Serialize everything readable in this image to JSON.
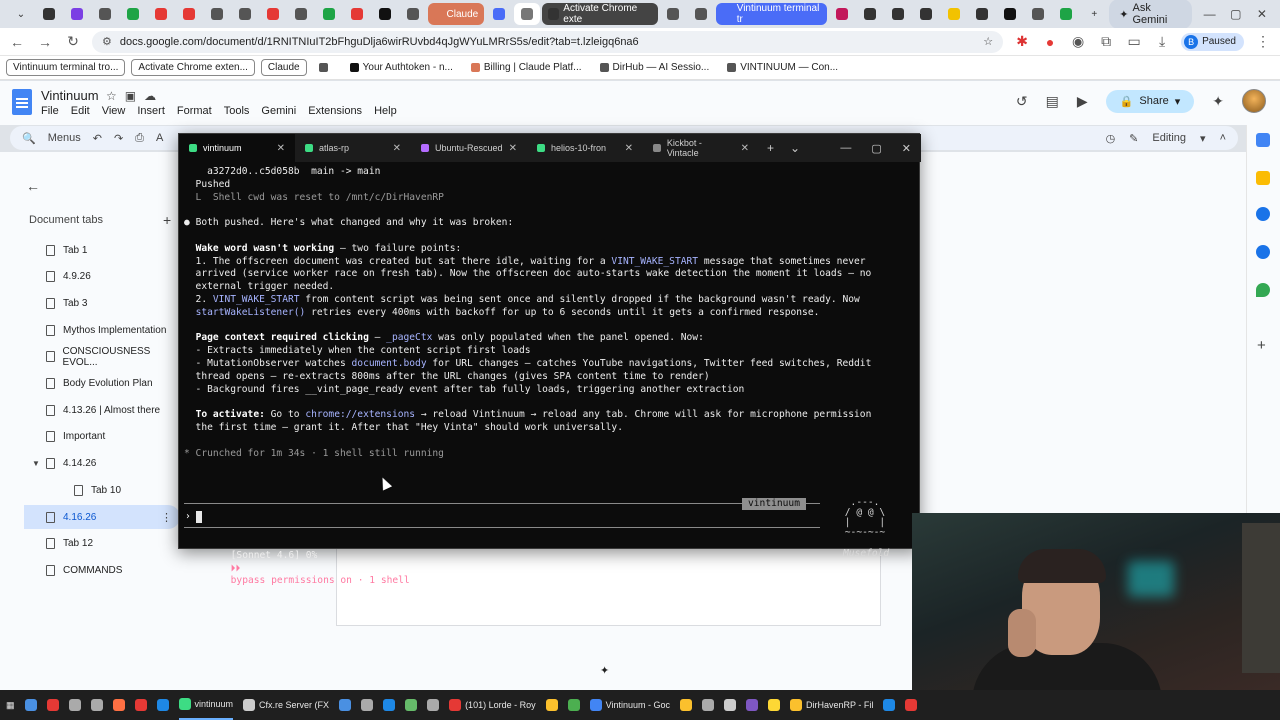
{
  "browser": {
    "tabs": [
      {
        "label": "",
        "color": "#333333"
      },
      {
        "label": "",
        "color": "#7b3fe4"
      },
      {
        "label": "",
        "color": "#555555"
      },
      {
        "label": "",
        "color": "#1ea446"
      },
      {
        "label": "",
        "color": "#e53935"
      },
      {
        "label": "",
        "color": "#e53935"
      },
      {
        "label": "",
        "color": "#555555"
      },
      {
        "label": "",
        "color": "#555555"
      },
      {
        "label": "",
        "color": "#e53935"
      },
      {
        "label": "",
        "color": "#555555"
      },
      {
        "label": "",
        "color": "#1ea446"
      },
      {
        "label": "",
        "color": "#e53935"
      },
      {
        "label": "",
        "color": "#111111"
      },
      {
        "label": "",
        "color": "#555555"
      },
      {
        "label": "Claude",
        "color": "#d97757"
      },
      {
        "label": "",
        "color": "#4a6cf7"
      },
      {
        "label": "",
        "color": "#777777"
      },
      {
        "label": "Activate Chrome exte",
        "color": "#333333"
      },
      {
        "label": "",
        "color": "#555555"
      },
      {
        "label": "",
        "color": "#555555"
      },
      {
        "label": "Vintinuum terminal tr",
        "color": "#4a6cf7"
      },
      {
        "label": "",
        "color": "#c2185b"
      },
      {
        "label": "",
        "color": "#333333"
      },
      {
        "label": "",
        "color": "#333333"
      },
      {
        "label": "",
        "color": "#333333"
      },
      {
        "label": "",
        "color": "#f2c200"
      },
      {
        "label": "",
        "color": "#333333"
      },
      {
        "label": "",
        "color": "#111111"
      },
      {
        "label": "",
        "color": "#555555"
      },
      {
        "label": "",
        "color": "#1ea446"
      }
    ],
    "new_tab": "+",
    "ask_gemini": "Ask Gemini",
    "window_controls": {
      "minimize": "—",
      "maximize": "▢",
      "close": "✕"
    },
    "url": "docs.google.com/document/d/1RNITNIuIT2bFhguDlja6wirRUvbd4qJgWYuLMRrS5s/edit?tab=t.lzleigq6na6",
    "profile_initial": "B",
    "profile_status": "Paused",
    "bookmarks": [
      {
        "label": "Vintinuum terminal tro...",
        "boxed": true,
        "color": ""
      },
      {
        "label": "Activate Chrome exten...",
        "boxed": true,
        "color": ""
      },
      {
        "label": "Claude",
        "boxed": true,
        "color": ""
      },
      {
        "label": "",
        "boxed": false,
        "color": "#555555"
      },
      {
        "label": "Your Authtoken - n...",
        "boxed": false,
        "color": "#111111"
      },
      {
        "label": "Billing | Claude Platf...",
        "boxed": false,
        "color": "#d97757"
      },
      {
        "label": "DirHub — AI Sessio...",
        "boxed": false,
        "color": "#555555"
      },
      {
        "label": "VINTINUUM — Con...",
        "boxed": false,
        "color": "#555555"
      }
    ]
  },
  "docs": {
    "title": "Vintinuum",
    "menu": [
      "File",
      "Edit",
      "View",
      "Insert",
      "Format",
      "Tools",
      "Gemini",
      "Extensions",
      "Help"
    ],
    "share_label": "Share",
    "toolbar_menus": "Menus",
    "editing_label": "Editing",
    "sidebar_heading": "Document tabs",
    "sidebar_add": "+",
    "tabs": [
      {
        "label": "Tab 1",
        "child": false,
        "selected": false,
        "expanded": false
      },
      {
        "label": "4.9.26",
        "child": false,
        "selected": false,
        "expanded": false
      },
      {
        "label": "Tab 3",
        "child": false,
        "selected": false,
        "expanded": false
      },
      {
        "label": "Mythos Implementation",
        "child": false,
        "selected": false,
        "expanded": false
      },
      {
        "label": "CONSCIOUSNESS EVOL...",
        "child": false,
        "selected": false,
        "expanded": false
      },
      {
        "label": "Body Evolution Plan",
        "child": false,
        "selected": false,
        "expanded": false
      },
      {
        "label": "4.13.26 | Almost there",
        "child": false,
        "selected": false,
        "expanded": false
      },
      {
        "label": "Important",
        "child": false,
        "selected": false,
        "expanded": false
      },
      {
        "label": "4.14.26",
        "child": false,
        "selected": false,
        "expanded": true
      },
      {
        "label": "Tab 10",
        "child": true,
        "selected": false,
        "expanded": false
      },
      {
        "label": "4.16.26",
        "child": false,
        "selected": true,
        "expanded": false
      },
      {
        "label": "Tab 12",
        "child": false,
        "selected": false,
        "expanded": false
      },
      {
        "label": "COMMANDS",
        "child": false,
        "selected": false,
        "expanded": false
      }
    ]
  },
  "terminal": {
    "tabs": [
      {
        "label": "vintinuum",
        "active": true,
        "color": "#3ddc84"
      },
      {
        "label": "atlas-rp",
        "active": false,
        "color": "#3ddc84"
      },
      {
        "label": "Ubuntu-Rescued",
        "active": false,
        "color": "#b46cff"
      },
      {
        "label": "helios-10-fron",
        "active": false,
        "color": "#3ddc84"
      },
      {
        "label": "Kickbot - Vintacle",
        "active": false,
        "color": "#888888"
      }
    ],
    "new_tab": "+",
    "dropdown": "⌄",
    "lines": [
      {
        "segments": [
          {
            "t": "    a3272d0..c5d058b  main -> main",
            "c": "wht"
          }
        ]
      },
      {
        "segments": [
          {
            "t": "  Pushed",
            "c": "wht"
          }
        ]
      },
      {
        "segments": [
          {
            "t": "  L  Shell cwd was reset to /mnt/c/DirHavenRP",
            "c": "dim"
          }
        ]
      },
      {
        "segments": [
          {
            "t": "",
            "c": ""
          }
        ]
      },
      {
        "segments": [
          {
            "t": "● ",
            "c": "wht"
          },
          {
            "t": "Both pushed. Here's what changed and why it was broken:",
            "c": "wht"
          }
        ]
      },
      {
        "segments": [
          {
            "t": "",
            "c": ""
          }
        ]
      },
      {
        "segments": [
          {
            "t": "  ",
            "c": ""
          },
          {
            "t": "Wake word wasn't working",
            "c": "bold"
          },
          {
            "t": " — two failure points:",
            "c": "wht"
          }
        ]
      },
      {
        "segments": [
          {
            "t": "  1. The offscreen document was created but sat there idle, waiting for a ",
            "c": "wht"
          },
          {
            "t": "VINT_WAKE_START",
            "c": "hl"
          },
          {
            "t": " message that sometimes never",
            "c": "wht"
          }
        ]
      },
      {
        "segments": [
          {
            "t": "  arrived (service worker race on fresh tab). Now the offscreen doc auto-starts wake detection the moment it loads — no",
            "c": "wht"
          }
        ]
      },
      {
        "segments": [
          {
            "t": "  external trigger needed.",
            "c": "wht"
          }
        ]
      },
      {
        "segments": [
          {
            "t": "  2. ",
            "c": "wht"
          },
          {
            "t": "VINT_WAKE_START",
            "c": "hl"
          },
          {
            "t": " from content script was being sent once and silently dropped if the background wasn't ready. Now",
            "c": "wht"
          }
        ]
      },
      {
        "segments": [
          {
            "t": "  ",
            "c": ""
          },
          {
            "t": "startWakeListener()",
            "c": "hl"
          },
          {
            "t": " retries every 400ms with backoff for up to 6 seconds until it gets a confirmed response.",
            "c": "wht"
          }
        ]
      },
      {
        "segments": [
          {
            "t": "",
            "c": ""
          }
        ]
      },
      {
        "segments": [
          {
            "t": "  ",
            "c": ""
          },
          {
            "t": "Page context required clicking",
            "c": "bold"
          },
          {
            "t": " — ",
            "c": "wht"
          },
          {
            "t": "_pageCtx",
            "c": "hl"
          },
          {
            "t": " was only populated when the panel opened. Now:",
            "c": "wht"
          }
        ]
      },
      {
        "segments": [
          {
            "t": "  - Extracts immediately when the content script first loads",
            "c": "wht"
          }
        ]
      },
      {
        "segments": [
          {
            "t": "  - MutationObserver watches ",
            "c": "wht"
          },
          {
            "t": "document.body",
            "c": "hl"
          },
          {
            "t": " for URL changes — catches YouTube navigations, Twitter feed switches, Reddit",
            "c": "wht"
          }
        ]
      },
      {
        "segments": [
          {
            "t": "  thread opens — re-extracts 800ms after the URL changes (gives SPA content time to render)",
            "c": "wht"
          }
        ]
      },
      {
        "segments": [
          {
            "t": "  - Background fires ",
            "c": "wht"
          },
          {
            "t": "__vint_page_ready",
            "c": "wht"
          },
          {
            "t": " event after tab fully loads, triggering another extraction",
            "c": "wht"
          }
        ]
      },
      {
        "segments": [
          {
            "t": "",
            "c": ""
          }
        ]
      },
      {
        "segments": [
          {
            "t": "  ",
            "c": ""
          },
          {
            "t": "To activate:",
            "c": "bold"
          },
          {
            "t": " Go to ",
            "c": "wht"
          },
          {
            "t": "chrome://extensions",
            "c": "hl"
          },
          {
            "t": " → reload Vintinuum → reload any tab. Chrome will ask for microphone permission",
            "c": "wht"
          }
        ]
      },
      {
        "segments": [
          {
            "t": "  the first time — grant it. After that \"Hey Vinta\" should work universally.",
            "c": "wht"
          }
        ]
      },
      {
        "segments": [
          {
            "t": "",
            "c": ""
          }
        ]
      },
      {
        "segments": [
          {
            "t": "* Crunched for 1m 34s · 1 shell still running",
            "c": "dim"
          }
        ]
      }
    ],
    "session_name": "vintinuum",
    "prompt_char": "›",
    "status_model": "[Sonnet 4.6] 0%",
    "status_perm_arrows": "⏵⏵",
    "status_perm": "bypass permissions on",
    "status_shell": " · 1 shell",
    "mascot_art": "  .---.\n / @ @ \\\n |     |\n ~-~-~-~",
    "mascot_name": "Musefold"
  },
  "taskbar": {
    "items": [
      {
        "label": "",
        "color": "#4a90e2"
      },
      {
        "label": "",
        "color": "#e53935"
      },
      {
        "label": "",
        "color": "#aaaaaa"
      },
      {
        "label": "",
        "color": "#aaaaaa"
      },
      {
        "label": "",
        "color": "#ff7043"
      },
      {
        "label": "",
        "color": "#e53935"
      },
      {
        "label": "",
        "color": "#1e88e5"
      },
      {
        "label": "vintinuum",
        "color": "#3ddc84",
        "active": true
      },
      {
        "label": "Cfx.re Server (FX",
        "color": "#cccccc"
      },
      {
        "label": "",
        "color": "#4a90e2"
      },
      {
        "label": "",
        "color": "#aaaaaa"
      },
      {
        "label": "",
        "color": "#1e88e5"
      },
      {
        "label": "",
        "color": "#66bb6a"
      },
      {
        "label": "",
        "color": "#aaaaaa"
      },
      {
        "label": "(101) Lorde - Roy",
        "color": "#e53935"
      },
      {
        "label": "",
        "color": "#fbc02d"
      },
      {
        "label": "",
        "color": "#4caf50"
      },
      {
        "label": "Vintinuum - Goc",
        "color": "#4285f4"
      },
      {
        "label": "",
        "color": "#fbc02d"
      },
      {
        "label": "",
        "color": "#aaaaaa"
      },
      {
        "label": "",
        "color": "#cccccc"
      },
      {
        "label": "",
        "color": "#7e57c2"
      },
      {
        "label": "",
        "color": "#fdd835"
      },
      {
        "label": "DirHavenRP - Fil",
        "color": "#fbc02d"
      },
      {
        "label": "",
        "color": "#1e88e5"
      },
      {
        "label": "",
        "color": "#e53935"
      }
    ]
  }
}
